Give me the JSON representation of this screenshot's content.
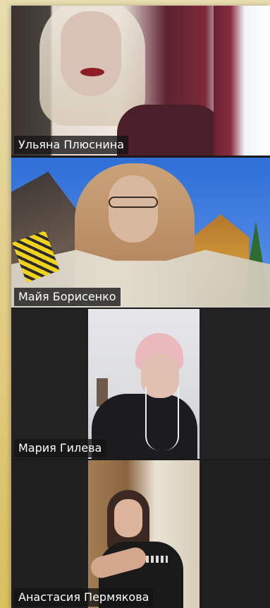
{
  "participants": [
    {
      "name": "Ульяна Плюснина",
      "active_speaker": false
    },
    {
      "name": "Майя Борисенко",
      "active_speaker": false
    },
    {
      "name": "Мария Гилева",
      "active_speaker": true
    },
    {
      "name": "Анастасия Пермякова",
      "active_speaker": false
    }
  ],
  "colors": {
    "active_speaker_border": "#9dc84a",
    "label_background": "#141414",
    "label_text": "#ffffff",
    "desktop_background": "#e3cf8a"
  }
}
